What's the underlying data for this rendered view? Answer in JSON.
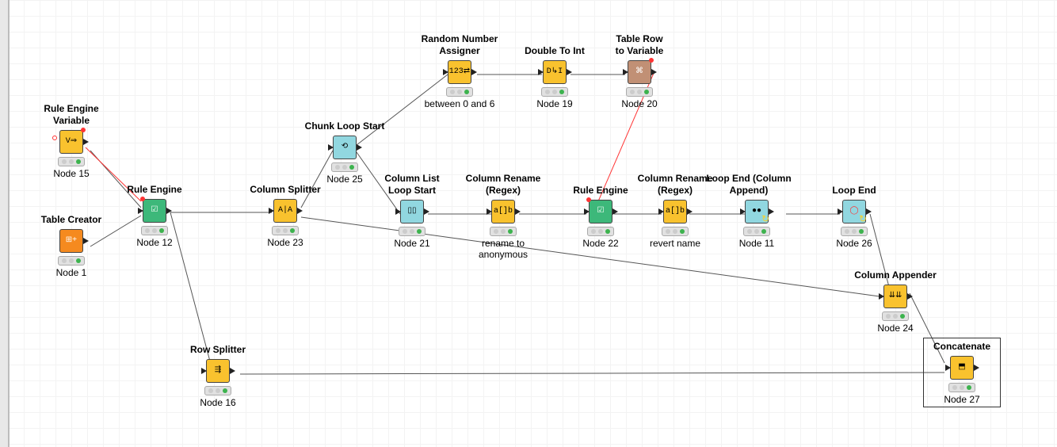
{
  "nodes": {
    "n15": {
      "title": "Rule Engine\nVariable",
      "sub": "Node 15"
    },
    "n1": {
      "title": "Table Creator",
      "sub": "Node 1"
    },
    "n12": {
      "title": "Rule Engine",
      "sub": "Node 12"
    },
    "n23": {
      "title": "Column Splitter",
      "sub": "Node 23"
    },
    "n25": {
      "title": "Chunk Loop Start",
      "sub": "Node 25"
    },
    "rna": {
      "title": "Random Number\nAssigner",
      "sub": "between 0 and 6"
    },
    "n19": {
      "title": "Double To Int",
      "sub": "Node 19"
    },
    "n20": {
      "title": "Table Row\nto Variable",
      "sub": "Node 20"
    },
    "n21": {
      "title": "Column List\nLoop Start",
      "sub": "Node 21"
    },
    "crr": {
      "title": "Column Rename\n(Regex)",
      "sub": "rename to\nanonymous"
    },
    "n22": {
      "title": "Rule Engine",
      "sub": "Node 22"
    },
    "crr2": {
      "title": "Column Rename\n(Regex)",
      "sub": "revert name"
    },
    "n11": {
      "title": "Loop End (Column\nAppend)",
      "sub": "Node 11"
    },
    "n26": {
      "title": "Loop End",
      "sub": "Node 26"
    },
    "n24": {
      "title": "Column Appender",
      "sub": "Node 24"
    },
    "n16": {
      "title": "Row Splitter",
      "sub": "Node 16"
    },
    "n27": {
      "title": "Concatenate",
      "sub": "Node 27"
    }
  },
  "icons": {
    "rule_var": "V⇒",
    "grid": "⊞+",
    "rule": "☑",
    "splitter": "A|A",
    "loop": "⟲",
    "rand": "123⇄",
    "d2i": "D↳I",
    "row2var": "⌘",
    "col_list": "▯▯",
    "rename": "a[]b",
    "loopend": "●●",
    "loopend2": "◯",
    "append": "⇊⇊",
    "rowsplit": "⇶",
    "concat": "⬒"
  }
}
